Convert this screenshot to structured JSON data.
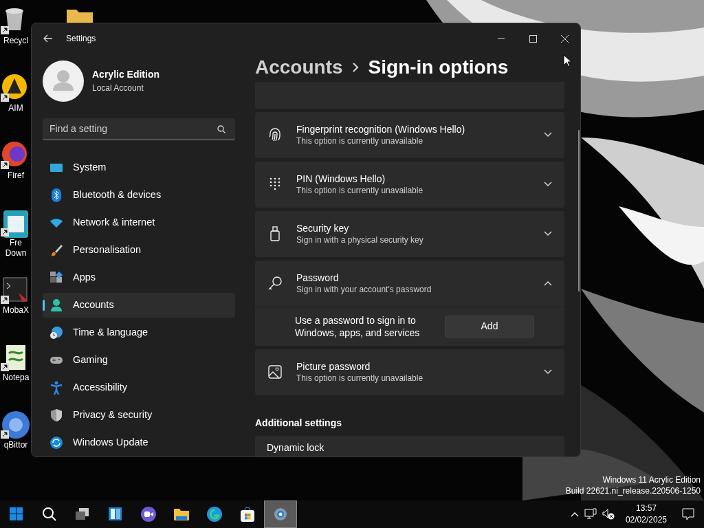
{
  "desktop": {
    "icons": [
      {
        "label": "Recycl"
      },
      {
        "label": "AIM"
      },
      {
        "label": "Firef"
      },
      {
        "label": "Fre Down"
      },
      {
        "label": "MobaX"
      },
      {
        "label": "Notepa"
      },
      {
        "label": "qBittor"
      }
    ],
    "watermark": [
      "Windows 11 Acrylic Edition",
      "Build 22621.ni_release.220506-1250"
    ]
  },
  "window": {
    "title": "Settings"
  },
  "profile": {
    "name": "Acrylic Edition",
    "account_type": "Local Account"
  },
  "search": {
    "placeholder": "Find a setting"
  },
  "nav": [
    {
      "label": "System",
      "selected": false
    },
    {
      "label": "Bluetooth & devices",
      "selected": false
    },
    {
      "label": "Network & internet",
      "selected": false
    },
    {
      "label": "Personalisation",
      "selected": false
    },
    {
      "label": "Apps",
      "selected": false
    },
    {
      "label": "Accounts",
      "selected": true
    },
    {
      "label": "Time & language",
      "selected": false
    },
    {
      "label": "Gaming",
      "selected": false
    },
    {
      "label": "Accessibility",
      "selected": false
    },
    {
      "label": "Privacy & security",
      "selected": false
    },
    {
      "label": "Windows Update",
      "selected": false
    }
  ],
  "breadcrumb": [
    "Accounts",
    "Sign-in options"
  ],
  "options": [
    {
      "title": "Fingerprint recognition (Windows Hello)",
      "subtitle": "This option is currently unavailable",
      "expanded": false
    },
    {
      "title": "PIN (Windows Hello)",
      "subtitle": "This option is currently unavailable",
      "expanded": false
    },
    {
      "title": "Security key",
      "subtitle": "Sign in with a physical security key",
      "expanded": false
    },
    {
      "title": "Password",
      "subtitle": "Sign in with your account's password",
      "expanded": true,
      "detail": "Use a password to sign in to Windows, apps, and services",
      "button": "Add"
    },
    {
      "title": "Picture password",
      "subtitle": "This option is currently unavailable",
      "expanded": false
    }
  ],
  "additional": {
    "heading": "Additional settings",
    "items": [
      {
        "title": "Dynamic lock"
      }
    ]
  },
  "taskbar": {
    "apps": [
      {
        "selected": false
      },
      {
        "selected": false
      },
      {
        "selected": false
      },
      {
        "selected": false
      },
      {
        "selected": false
      },
      {
        "selected": false
      },
      {
        "selected": false
      },
      {
        "selected": false
      },
      {
        "selected": true
      }
    ],
    "time": "13:57",
    "date": "02/02/2025"
  }
}
